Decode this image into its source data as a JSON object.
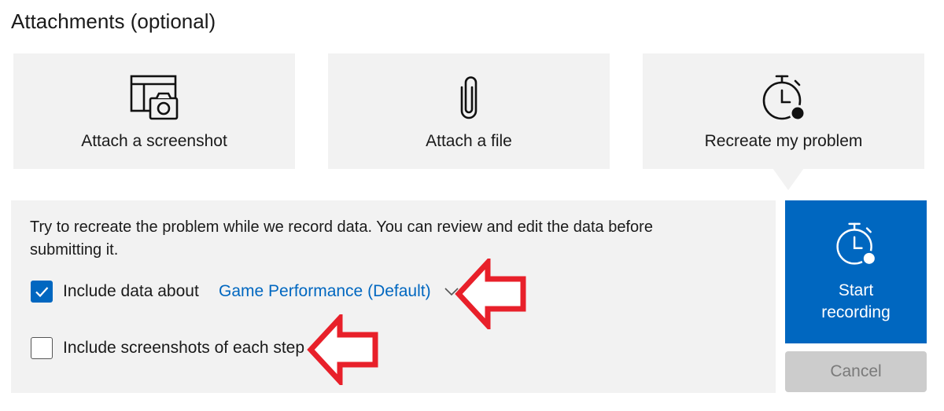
{
  "section": {
    "title": "Attachments (optional)"
  },
  "tiles": [
    {
      "label": "Attach a screenshot",
      "icon": "screenshot-camera-icon"
    },
    {
      "label": "Attach a file",
      "icon": "paperclip-icon"
    },
    {
      "label": "Recreate my problem",
      "icon": "stopwatch-record-icon"
    }
  ],
  "panel": {
    "description": "Try to recreate the problem while we record data. You can review and edit the data before submitting it.",
    "include_data": {
      "label": "Include data about",
      "checked": true,
      "dropdown_value": "Game Performance (Default)"
    },
    "include_screenshots": {
      "label": "Include screenshots of each step",
      "checked": false
    }
  },
  "actions": {
    "start_label": "Start\nrecording",
    "cancel_label": "Cancel"
  },
  "colors": {
    "accent": "#0067c0",
    "tile_bg": "#f2f2f2",
    "annotation_arrow": "#e8202a",
    "disabled_bg": "#cccccc"
  }
}
